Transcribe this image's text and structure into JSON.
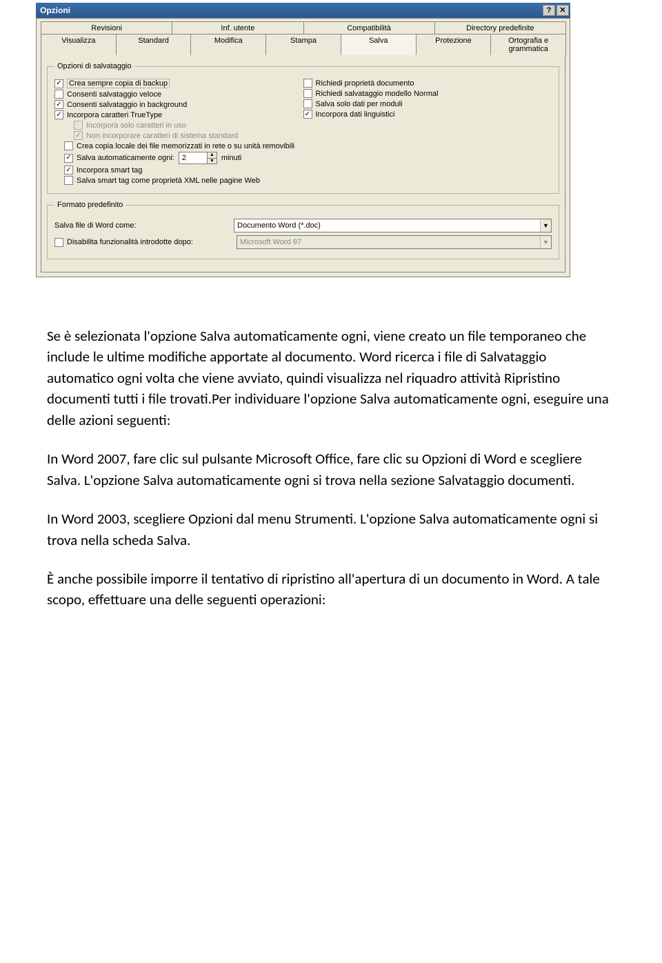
{
  "dialog": {
    "title": "Opzioni",
    "tabs_row1": [
      "Revisioni",
      "Inf. utente",
      "Compatibilità",
      "Directory predefinite"
    ],
    "tabs_row2": [
      "Visualizza",
      "Standard",
      "Modifica",
      "Stampa",
      "Salva",
      "Protezione",
      "Ortografia e grammatica"
    ],
    "active_tab": "Salva",
    "save_options": {
      "legend": "Opzioni di salvataggio",
      "left": {
        "backup": "Crea sempre copia di backup",
        "fastsave": "Consenti salvataggio veloce",
        "background": "Consenti salvataggio in background",
        "truetype": "Incorpora caratteri TrueType",
        "only_used": "Incorpora solo caratteri in uso",
        "no_system": "Non incorporare caratteri di sistema standard",
        "local_copy": "Crea copia locale dei file memorizzati in rete o su unità removibili",
        "autosave": "Salva automaticamente ogni:",
        "autosave_value": "2",
        "autosave_unit": "minuti",
        "smarttag": "Incorpora smart tag",
        "smarttag_xml": "Salva smart tag come proprietà XML nelle pagine Web"
      },
      "right": {
        "prompt_props": "Richiedi proprietà documento",
        "prompt_normal": "Richiedi salvataggio modello Normal",
        "data_only": "Salva solo dati per moduli",
        "linguistic": "Incorpora dati linguistici"
      }
    },
    "default_format": {
      "legend": "Formato predefinito",
      "save_as_label": "Salva file di Word come:",
      "save_as_value": "Documento Word (*.doc)",
      "disable_after_label": "Disabilita funzionalità introdotte dopo:",
      "disable_after_value": "Microsoft Word 97"
    }
  },
  "doc": {
    "p1": "Se è selezionata l'opzione Salva automaticamente ogni, viene creato un file temporaneo che include le ultime modifiche apportate al documento. Word ricerca i file di Salvataggio automatico ogni volta che viene avviato, quindi visualizza nel riquadro attività Ripristino documenti tutti i file trovati.Per individuare l'opzione Salva automaticamente ogni, eseguire una delle azioni seguenti:",
    "p2": "In Word 2007, fare clic sul pulsante Microsoft Office, fare clic su Opzioni di Word e scegliere Salva. L'opzione Salva automaticamente ogni si trova nella sezione Salvataggio documenti.",
    "p3": "In Word 2003, scegliere Opzioni dal menu Strumenti. L'opzione Salva automaticamente ogni si trova nella scheda Salva.",
    "p4": "È anche possibile imporre il tentativo di ripristino all'apertura di un documento in Word. A tale scopo, effettuare una delle seguenti operazioni:"
  }
}
